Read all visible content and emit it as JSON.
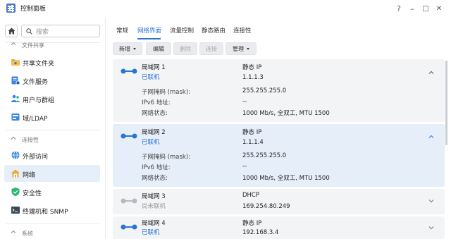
{
  "window": {
    "title": "控制面板",
    "controls": {
      "help": "?",
      "minimize": "–",
      "maximize": "□",
      "close": "✕"
    }
  },
  "sidebar": {
    "search_placeholder": "搜索",
    "sections": [
      {
        "label": "文件共享",
        "items": [
          {
            "label": "共享文件夹",
            "icon": "shared-folder-icon"
          },
          {
            "label": "文件服务",
            "icon": "file-services-icon"
          },
          {
            "label": "用户与群组",
            "icon": "users-groups-icon"
          },
          {
            "label": "域/LDAP",
            "icon": "domain-ldap-icon"
          }
        ]
      },
      {
        "label": "连接性",
        "items": [
          {
            "label": "外部访问",
            "icon": "external-access-icon"
          },
          {
            "label": "网络",
            "icon": "network-icon",
            "active": true
          },
          {
            "label": "安全性",
            "icon": "security-shield-icon"
          },
          {
            "label": "终端机和 SNMP",
            "icon": "terminal-snmp-icon"
          }
        ]
      },
      {
        "label": "系统",
        "items": []
      }
    ]
  },
  "tabs": [
    {
      "label": "常规"
    },
    {
      "label": "网络界面",
      "active": true
    },
    {
      "label": "流量控制"
    },
    {
      "label": "静态路由"
    },
    {
      "label": "连接性"
    }
  ],
  "toolbar": {
    "create": "新增",
    "edit": "编辑",
    "delete": "删除",
    "connect": "连接",
    "manage": "管理"
  },
  "interfaces": [
    {
      "name": "局域网 1",
      "status": "已联机",
      "mode": "静态 IP",
      "ip": "1.1.1.3",
      "expanded": true,
      "details": [
        {
          "label": "子网掩码 (mask):",
          "value": "255.255.255.0"
        },
        {
          "label": "IPv6 地址:",
          "value": "--"
        },
        {
          "label": "网络状态:",
          "value": "1000 Mb/s, 全双工, MTU 1500"
        }
      ]
    },
    {
      "name": "局域网 2",
      "status": "已联机",
      "mode": "静态 IP",
      "ip": "1.1.1.4",
      "expanded": true,
      "selected": true,
      "details": [
        {
          "label": "子网掩码 (mask):",
          "value": "255.255.255.0"
        },
        {
          "label": "IPv6 地址:",
          "value": "--"
        },
        {
          "label": "网络状态:",
          "value": "1000 Mb/s, 全双工, MTU 1500"
        }
      ]
    },
    {
      "name": "局域网 3",
      "status": "尚未联机",
      "mode": "DHCP",
      "ip": "169.254.80.249",
      "expanded": false,
      "connected": false
    },
    {
      "name": "局域网 4",
      "status": "已联机",
      "mode": "静态 IP",
      "ip": "192.168.3.4",
      "expanded": false
    }
  ],
  "colors": {
    "accent": "#2a74d2",
    "selected_bg": "#e6eef9",
    "card_bg": "#f2f4f6",
    "disconnected": "#999999"
  }
}
